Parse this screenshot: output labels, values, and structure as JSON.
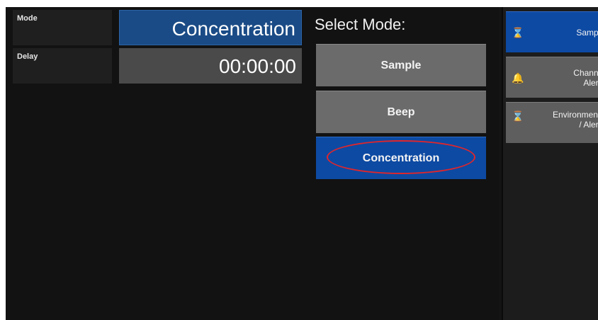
{
  "fields": {
    "mode_label": "Mode",
    "mode_value": "Concentration",
    "delay_label": "Delay",
    "delay_value": "00:00:00"
  },
  "select_mode": {
    "title": "Select Mode:",
    "options": [
      "Sample",
      "Beep",
      "Concentration"
    ],
    "selected": "Concentration"
  },
  "sidebar": {
    "items": [
      {
        "line1": "Sample",
        "line2": "",
        "icon": "hourglass-icon"
      },
      {
        "line1": "Channel",
        "line2": "Alerts",
        "icon": "bell-icon"
      },
      {
        "line1": "Environmenta",
        "line2": "/ Alerts",
        "icon": "hourglass-icon"
      }
    ]
  },
  "colors": {
    "selected_blue": "#0d4aa3",
    "button_gray": "#6b6b6b",
    "annotation_red": "#e0262b",
    "icon_yellow": "#f2d218"
  }
}
